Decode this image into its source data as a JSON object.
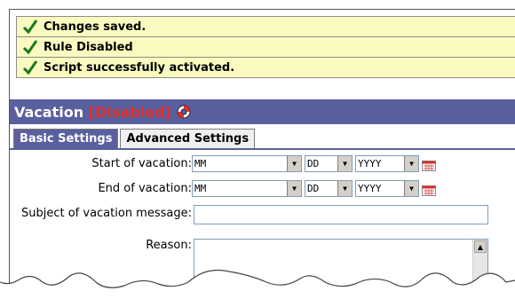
{
  "messages": [
    {
      "text": "Changes saved.",
      "icon": "checkmark-icon"
    },
    {
      "text": "Rule Disabled",
      "icon": "checkmark-icon"
    },
    {
      "text": "Script successfully activated.",
      "icon": "checkmark-icon"
    }
  ],
  "title": {
    "name": "Vacation",
    "open": "[",
    "status": "Disabled",
    "close": "]"
  },
  "tabs": {
    "basic": "Basic Settings",
    "advanced": "Advanced Settings"
  },
  "form": {
    "start_label": "Start of vacation:",
    "end_label": "End of vacation:",
    "subject_label": "Subject of vacation message:",
    "reason_label": "Reason:",
    "month": "MM",
    "day": "DD",
    "year": "YYYY",
    "subject_value": ""
  },
  "colors": {
    "accent": "#5a5f9e",
    "status_red": "#e0302a",
    "message_bg": "#fafac0"
  }
}
